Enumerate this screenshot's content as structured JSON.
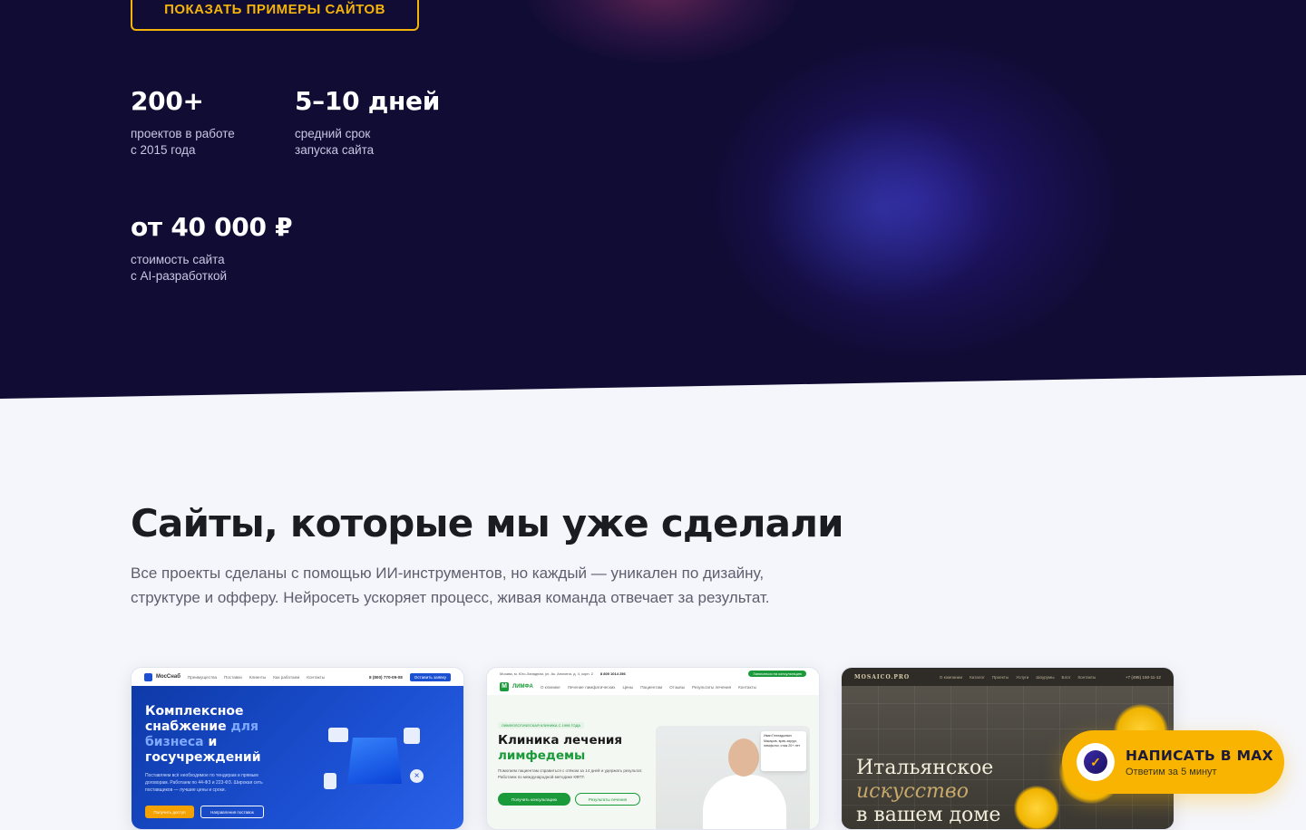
{
  "hero": {
    "cta_label": "ПОКАЗАТЬ ПРИМЕРЫ САЙТОВ",
    "stats": [
      {
        "value": "200+",
        "caption_line1": "проектов в работе",
        "caption_line2": "с 2015 года"
      },
      {
        "value": "5–10 дней",
        "caption_line1": "средний срок",
        "caption_line2": "запуска сайта"
      },
      {
        "value": "от 40 000 ₽",
        "caption_line1": "стоимость сайта",
        "caption_line2": "с AI-разработкой"
      }
    ]
  },
  "portfolio": {
    "title": "Сайты, которые мы уже сделали",
    "description": "Все проекты сделаны с помощью ИИ-инструментов, но каждый — уникален по дизайну, структуре и офферу. Нейросеть ускоряет процесс, живая команда отвечает за результат.",
    "cards": [
      {
        "logo": "МосСнаб",
        "nav": [
          "Преимущества",
          "Поставки",
          "Клиенты",
          "Как работаем",
          "Контакты"
        ],
        "phone": "8 (800) 770-09-08",
        "nav_button": "Оставить заявку",
        "headline_a": "Комплексное снабжение ",
        "headline_b": "для бизнеса",
        "headline_c": " и госучреждений",
        "text": "Поставляем всё необходимое по тендерам и прямым договорам. Работаем по 44-ФЗ и 223-ФЗ. Широкая сеть поставщиков — лучшие цены и сроки.",
        "button_primary": "Получить доступ",
        "button_secondary": "Направления поставок"
      },
      {
        "logo": "ЛИМФА",
        "address": "Москва, м. Юго-Западная, ул. Ак. Анохина, д. 4, корп. 2",
        "phone": "8 800 1014 256",
        "nav_button": "Записаться на консультацию",
        "nav": [
          "О клинике",
          "Лечение лимфатических",
          "Цены",
          "Пациентам",
          "Отзывы",
          "Результаты лечения",
          "Контакты"
        ],
        "tag": "ЛИМФОЛОГИЧЕСКАЯ КЛИНИКА С 1998 ГОДА",
        "headline_a": "Клиника лечения",
        "headline_b": "лимфедемы",
        "text": "Помогаем пациентам справиться с отёком за 14 дней и удержать результат. Работаем по международной методике КФПТ.",
        "button_primary": "Получить консультацию",
        "button_secondary": "Результаты лечения",
        "doctor_note": "Иван Геннадьевич Макаров, врач-хирург, лимфолог, стаж 20+ лет"
      },
      {
        "logo": "MOSAICO.PRO",
        "nav": [
          "О компании",
          "Каталог",
          "Проекты",
          "Услуги",
          "Шоурумы",
          "Блог",
          "Контакты"
        ],
        "phone": "+7 (495) 150-11-12",
        "headline_a": "Итальянское",
        "headline_b": "искусство",
        "headline_c": "в вашем доме"
      }
    ]
  },
  "messenger": {
    "title": "НАПИСАТЬ В MAX",
    "subtitle": "Ответим за 5 минут",
    "icon": "check-icon"
  },
  "colors": {
    "hero_bg": "#100c33",
    "accent": "#f5b40a",
    "section_bg": "#f5f6fb"
  }
}
